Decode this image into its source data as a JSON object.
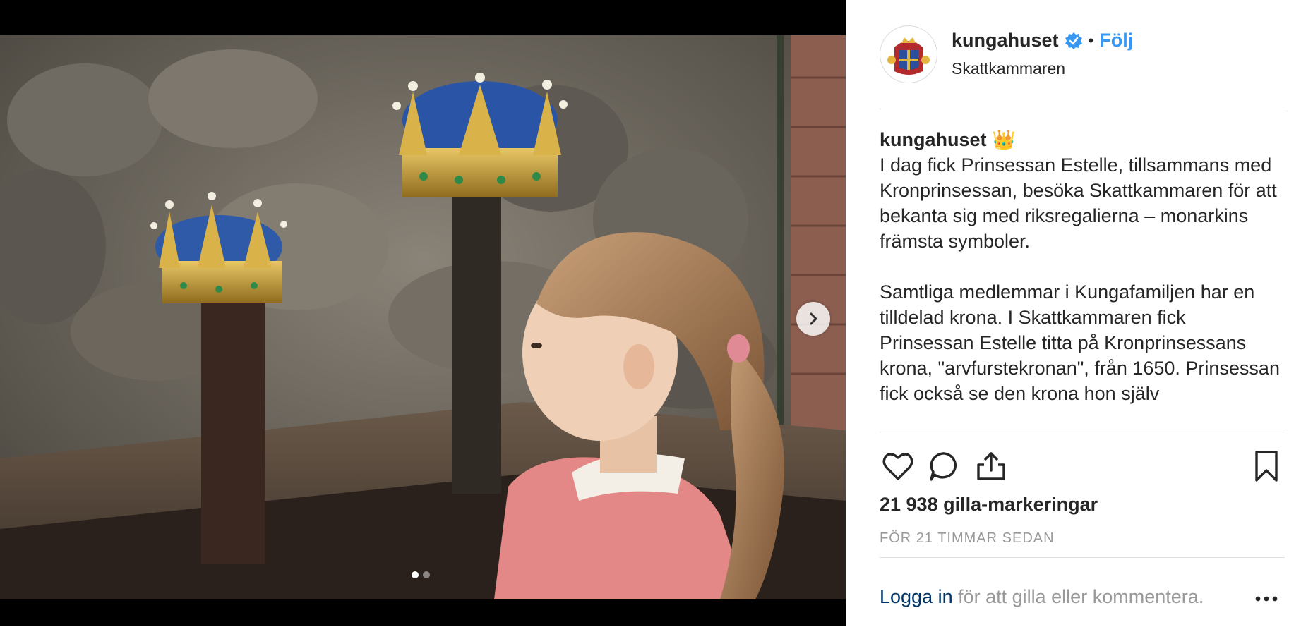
{
  "post": {
    "username": "kungahuset",
    "follow_label": "Följ",
    "separator": "•",
    "location": "Skattkammaren",
    "caption_user": "kungahuset",
    "caption_emoji": "👑",
    "caption_p1": "I dag fick Prinsessan Estelle, tillsammans med Kronprinsessan, besöka Skattkammaren för att bekanta sig med riksregalierna – monarkins främsta symboler.",
    "caption_p2": "Samtliga medlemmar i Kungafamiljen har en tilldelad krona. I Skattkammaren fick Prinsessan Estelle titta på Kronprinsessans krona, \"arvfurstekronan\", från 1650. Prinsessan fick också se den krona hon själv",
    "likes": "21 938 gilla-markeringar",
    "time_ago": "FÖR 21 TIMMAR SEDAN",
    "login_link": "Logga in",
    "login_rest": " för att gilla eller kommentera."
  },
  "carousel": {
    "current": 1,
    "total": 2
  },
  "icons": {
    "verified": "verified-badge-icon",
    "like": "heart-icon",
    "comment": "comment-bubble-icon",
    "share": "share-icon",
    "save": "bookmark-icon",
    "more": "more-dots-icon",
    "next": "chevron-right-icon"
  },
  "colors": {
    "accent": "#3897f0",
    "link": "#003569",
    "muted": "#999999",
    "text": "#262626"
  }
}
